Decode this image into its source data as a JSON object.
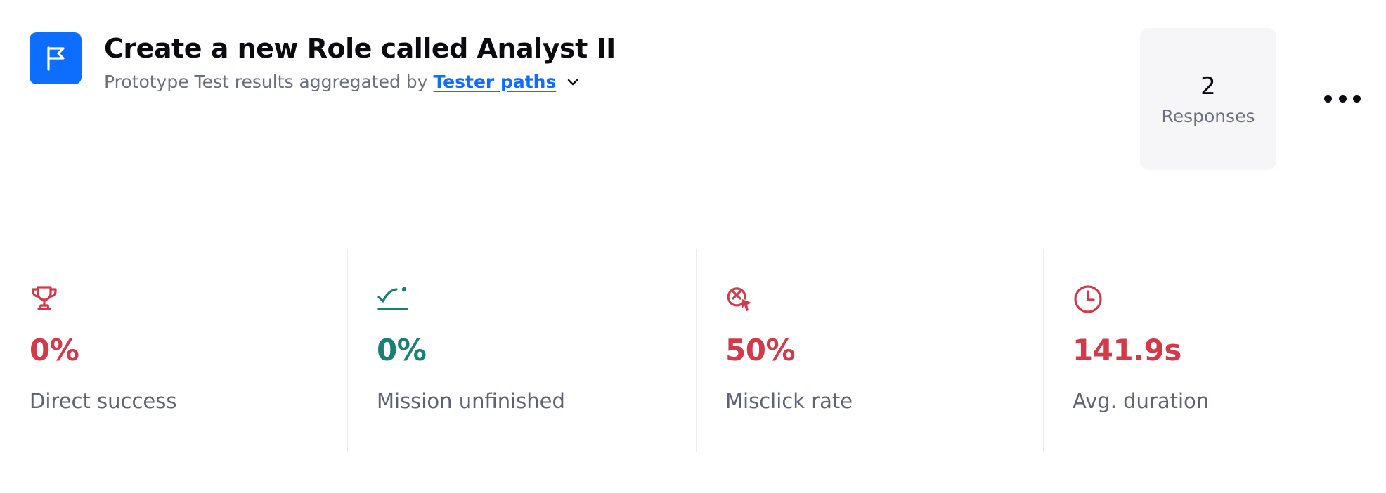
{
  "header": {
    "title": "Create a new Role called Analyst II",
    "subtitle_prefix": "Prototype Test results aggregated by",
    "aggregation_link": "Tester paths",
    "badge_icon": "flag-icon",
    "badge_color": "#0d6efd"
  },
  "responses": {
    "count": "2",
    "label": "Responses"
  },
  "more_menu_icon": "ellipsis-icon",
  "metrics": [
    {
      "value": "0%",
      "label": "Direct success",
      "icon": "trophy-icon",
      "color": "#d23a4a"
    },
    {
      "value": "0%",
      "label": "Mission unfinished",
      "icon": "mission-unfinished-icon",
      "color": "#1a7f74"
    },
    {
      "value": "50%",
      "label": "Misclick rate",
      "icon": "misclick-icon",
      "color": "#d23a4a"
    },
    {
      "value": "141.9s",
      "label": "Avg. duration",
      "icon": "clock-icon",
      "color": "#d23a4a"
    }
  ]
}
